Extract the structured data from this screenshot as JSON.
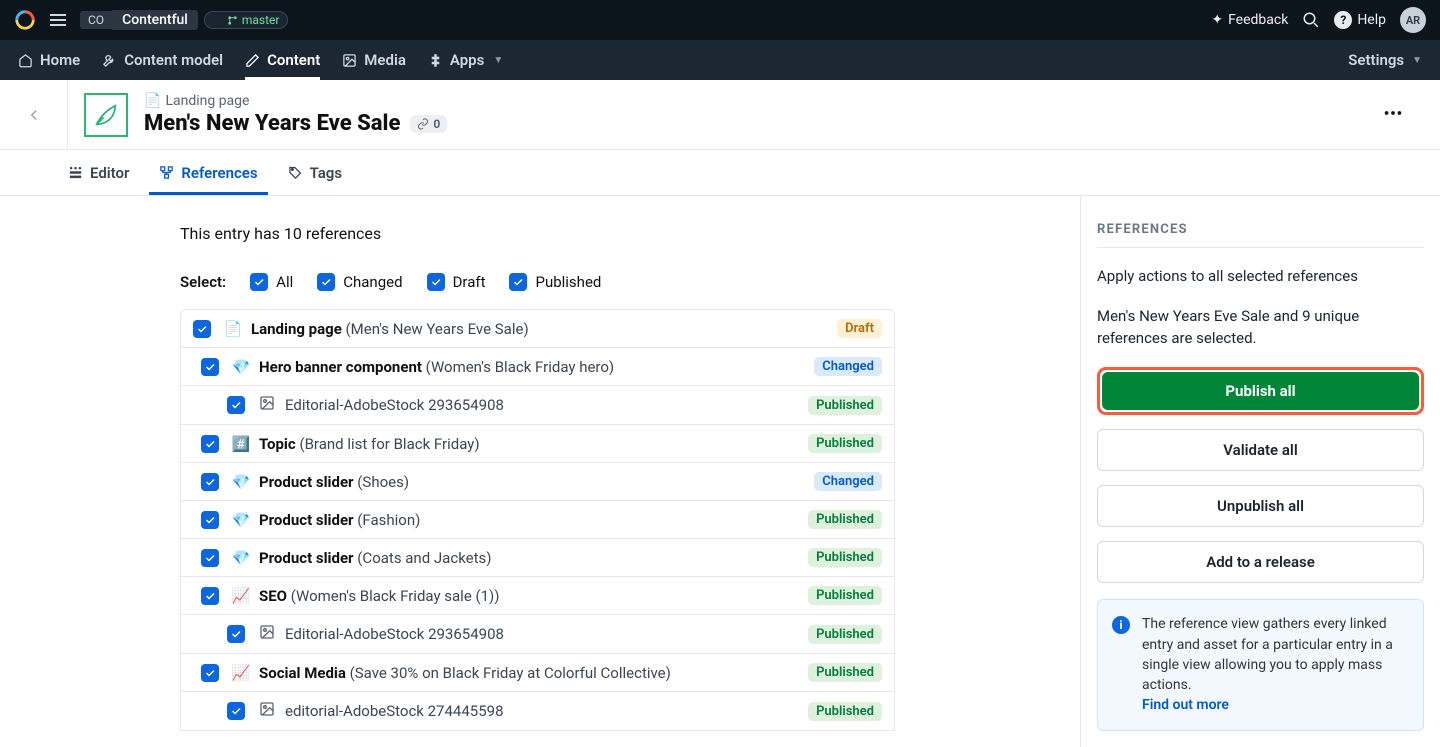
{
  "topbar": {
    "space_abbrev": "CO",
    "project_name": "Contentful",
    "environment": "master",
    "feedback_label": "Feedback",
    "help_label": "Help",
    "avatar_initials": "AR"
  },
  "nav": {
    "home": "Home",
    "content_model": "Content model",
    "content": "Content",
    "media": "Media",
    "apps": "Apps",
    "settings": "Settings"
  },
  "header": {
    "breadcrumb_icon": "📄",
    "breadcrumb": "Landing page",
    "title": "Men's New Years Eve Sale",
    "link_count": "0"
  },
  "tabs": {
    "editor": "Editor",
    "references": "References",
    "tags": "Tags"
  },
  "refs": {
    "count_line": "This entry has 10 references",
    "select_label": "Select:",
    "filters": {
      "all": "All",
      "changed": "Changed",
      "draft": "Draft",
      "published": "Published"
    },
    "tree": [
      {
        "level": 0,
        "icon": "📄",
        "type": "Landing page",
        "name": "(Men's New Years Eve Sale)",
        "status": "Draft"
      },
      {
        "level": 1,
        "icon": "💎",
        "type": "Hero banner component",
        "name": "(Women's Black Friday hero)",
        "status": "Changed"
      },
      {
        "level": 2,
        "icon": "img",
        "type": "",
        "name": "Editorial-AdobeStock 293654908",
        "status": "Published"
      },
      {
        "level": 1,
        "icon": "#️⃣",
        "type": "Topic",
        "name": "(Brand list for Black Friday)",
        "status": "Published"
      },
      {
        "level": 1,
        "icon": "💎",
        "type": "Product slider",
        "name": "(Shoes)",
        "status": "Changed"
      },
      {
        "level": 1,
        "icon": "💎",
        "type": "Product slider",
        "name": "(Fashion)",
        "status": "Published"
      },
      {
        "level": 1,
        "icon": "💎",
        "type": "Product slider",
        "name": "(Coats and Jackets)",
        "status": "Published"
      },
      {
        "level": 1,
        "icon": "📈",
        "type": "SEO",
        "name": "(Women's Black Friday sale (1))",
        "status": "Published"
      },
      {
        "level": 2,
        "icon": "img",
        "type": "",
        "name": "Editorial-AdobeStock 293654908",
        "status": "Published"
      },
      {
        "level": 1,
        "icon": "📈",
        "type": "Social Media",
        "name": "(Save 30% on Black Friday at Colorful Collective)",
        "status": "Published"
      },
      {
        "level": 2,
        "icon": "img",
        "type": "",
        "name": "editorial-AdobeStock 274445598",
        "status": "Published"
      }
    ]
  },
  "panel": {
    "heading": "REFERENCES",
    "apply_text": "Apply actions to all selected references",
    "selection_text": "Men's New Years Eve Sale and 9 unique references are selected.",
    "publish_all": "Publish all",
    "validate_all": "Validate all",
    "unpublish_all": "Unpublish all",
    "add_to_release": "Add to a release",
    "info_text": "The reference view gathers every linked entry and asset for a particular entry in a single view allowing you to apply mass actions.",
    "info_link": "Find out more"
  }
}
